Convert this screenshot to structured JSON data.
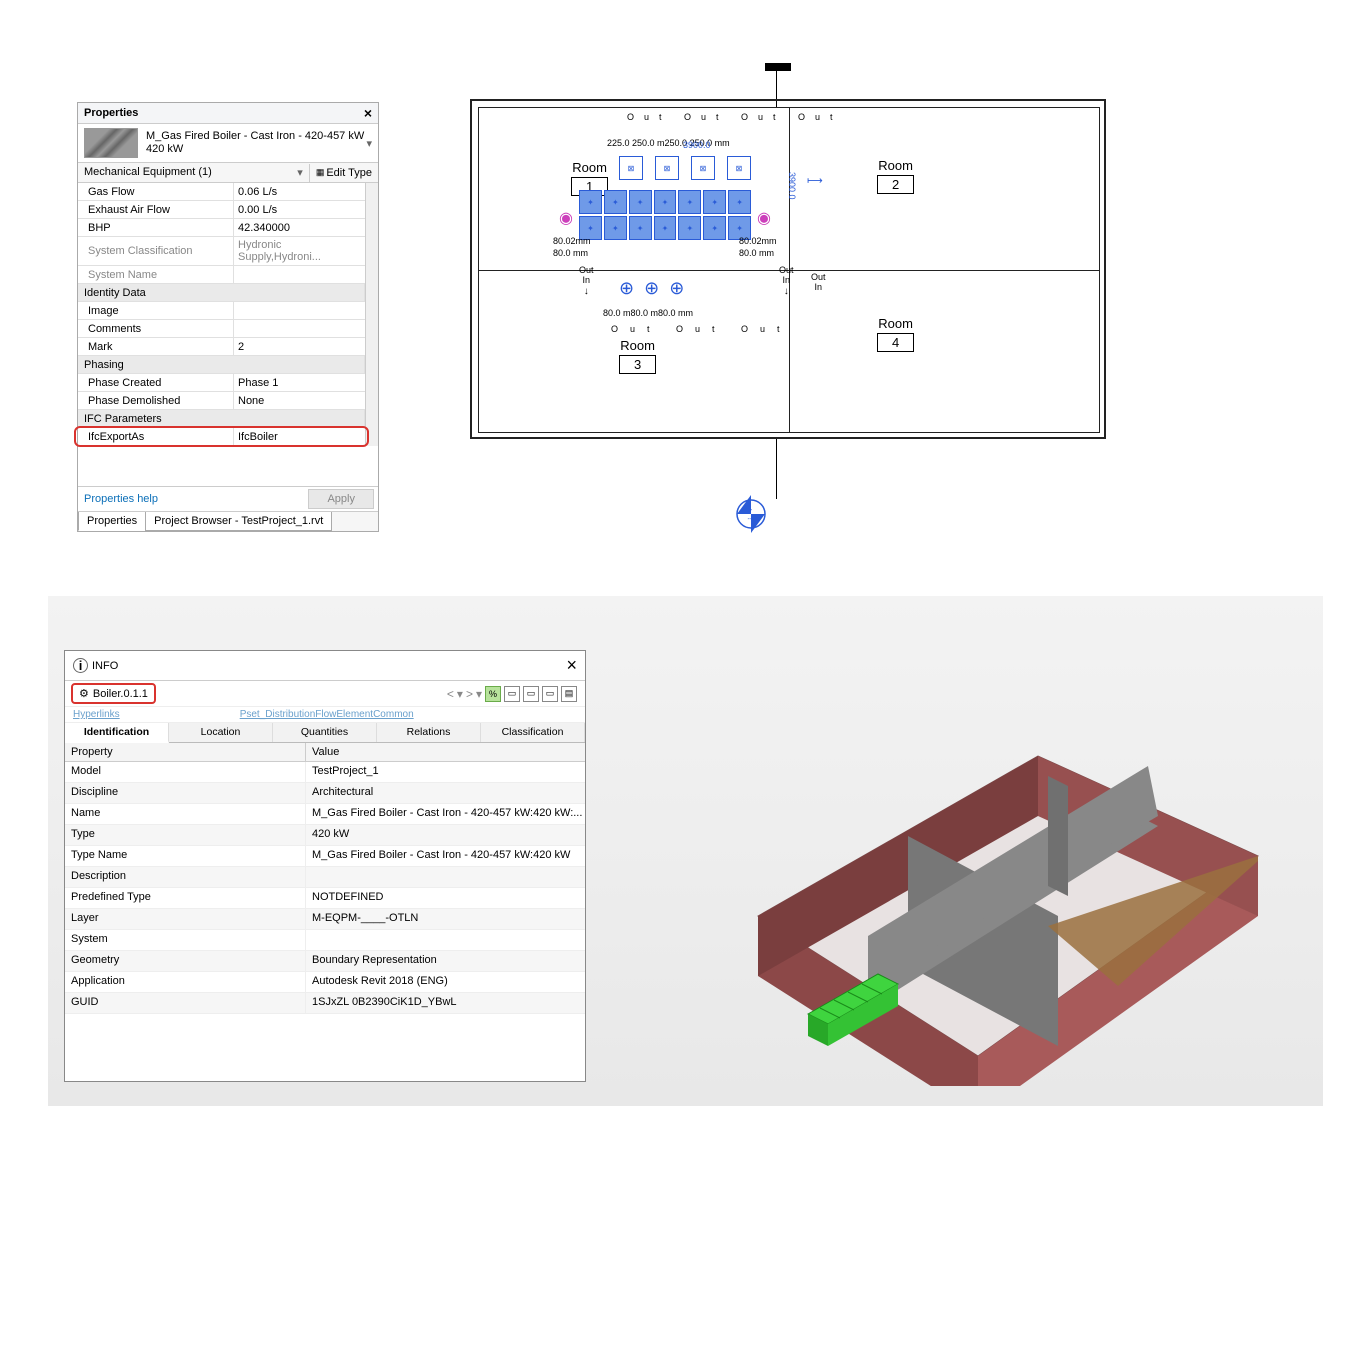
{
  "properties": {
    "title": "Properties",
    "family": "M_Gas Fired Boiler - Cast Iron - 420-457 kW",
    "type": "420 kW",
    "category_selector": "Mechanical Equipment (1)",
    "edit_type": "Edit Type",
    "groups": [
      {
        "kind": "row",
        "label": "Gas Flow",
        "value": "0.06 L/s"
      },
      {
        "kind": "row",
        "label": "Exhaust Air Flow",
        "value": "0.00 L/s"
      },
      {
        "kind": "row",
        "label": "BHP",
        "value": "42.340000"
      },
      {
        "kind": "row",
        "label": "System Classification",
        "value": "Hydronic Supply,Hydroni...",
        "readonly": true
      },
      {
        "kind": "row",
        "label": "System Name",
        "value": "",
        "readonly": true
      },
      {
        "kind": "group",
        "label": "Identity Data"
      },
      {
        "kind": "row",
        "label": "Image",
        "value": ""
      },
      {
        "kind": "row",
        "label": "Comments",
        "value": ""
      },
      {
        "kind": "row",
        "label": "Mark",
        "value": "2"
      },
      {
        "kind": "group",
        "label": "Phasing"
      },
      {
        "kind": "row",
        "label": "Phase Created",
        "value": "Phase 1"
      },
      {
        "kind": "row",
        "label": "Phase Demolished",
        "value": "None"
      },
      {
        "kind": "group",
        "label": "IFC Parameters"
      },
      {
        "kind": "row",
        "label": "IfcExportAs",
        "value": "IfcBoiler",
        "hl": true
      }
    ],
    "help": "Properties help",
    "apply": "Apply",
    "tabs": [
      "Properties",
      "Project Browser - TestProject_1.rvt"
    ]
  },
  "plan": {
    "rooms": [
      {
        "name": "Room",
        "num": "1",
        "pos": "r1"
      },
      {
        "name": "Room",
        "num": "2",
        "pos": "r2"
      },
      {
        "name": "Room",
        "num": "3",
        "pos": "r3"
      },
      {
        "name": "Room",
        "num": "4",
        "pos": "r4"
      }
    ],
    "dims_top": "225.0 250.0 m250.0 250.0 mm",
    "dims_span_h": "3900.0",
    "dims_span_v": "3900.0",
    "dims_left": "80.02mm",
    "dims_left2": "80.0 mm",
    "dims_right": "80.02mm",
    "dims_right2": "80.0 mm",
    "dims_row3": "80.0 m80.0 m80.0 mm",
    "out_labels": [
      "Out",
      "Out",
      "Out",
      "Out"
    ],
    "compass_top": "-",
    "compass_bot": "---"
  },
  "info": {
    "title": "INFO",
    "crumb": "Boiler.0.1.1",
    "hyperlinks_label": "Hyperlinks",
    "pset_label": "Pset_DistributionFlowElementCommon",
    "tabs": [
      "Identification",
      "Location",
      "Quantities",
      "Relations",
      "Classification"
    ],
    "col1": "Property",
    "col2": "Value",
    "rows": [
      {
        "p": "Model",
        "v": "TestProject_1"
      },
      {
        "p": "Discipline",
        "v": "Architectural"
      },
      {
        "p": "Name",
        "v": "M_Gas Fired Boiler - Cast Iron - 420-457 kW:420 kW:..."
      },
      {
        "p": "Type",
        "v": "420 kW"
      },
      {
        "p": "Type Name",
        "v": "M_Gas Fired Boiler - Cast Iron - 420-457 kW:420 kW"
      },
      {
        "p": "Description",
        "v": ""
      },
      {
        "p": "Predefined Type",
        "v": "NOTDEFINED"
      },
      {
        "p": "Layer",
        "v": "M-EQPM-____-OTLN"
      },
      {
        "p": "System",
        "v": ""
      },
      {
        "p": "Geometry",
        "v": "Boundary Representation"
      },
      {
        "p": "Application",
        "v": "Autodesk Revit 2018 (ENG)"
      },
      {
        "p": "GUID",
        "v": "1SJxZL 0B2390CiK1D_YBwL"
      }
    ]
  }
}
